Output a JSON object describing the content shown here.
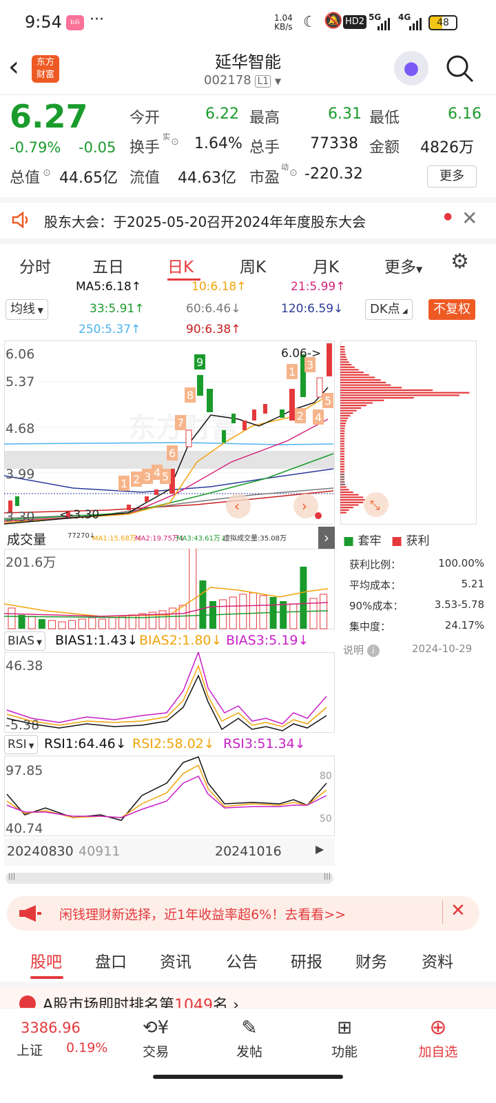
{
  "status_bar": {
    "time": "9:54",
    "app_badge": "bilibili",
    "dots": "···",
    "speed_val": "1.04",
    "speed_unit": "KB/s",
    "hd": "HD2",
    "net1": "5G",
    "net2": "4G",
    "battery": "48"
  },
  "nav": {
    "title": "延华智能",
    "code": "002178",
    "level": "L1",
    "logo_line1": "东方",
    "logo_line2": "财富"
  },
  "quote": {
    "price": "6.27",
    "change_pct": "-0.79%",
    "change": "-0.05",
    "open_label": "今开",
    "open": "6.22",
    "high_label": "最高",
    "high": "6.31",
    "low_label": "最低",
    "low": "6.16",
    "turnover_label": "换手",
    "turnover_sup": "实",
    "turnover": "1.64%",
    "volume_label": "总手",
    "volume": "77338",
    "amount_label": "金额",
    "amount": "4826万",
    "mcap_label": "总值",
    "mcap": "44.65亿",
    "float_label": "流值",
    "float": "44.63亿",
    "pe_label": "市盈",
    "pe_sup": "动",
    "pe": "-220.32",
    "more": "更多"
  },
  "notice": {
    "text": "股东大会：于2025-05-20召开2024年年度股东大会"
  },
  "period_tabs": [
    "分时",
    "五日",
    "日K",
    "周K",
    "月K",
    "更多"
  ],
  "active_tab": 2,
  "ma": {
    "ma_select": "均线",
    "ma5": "MA5:6.18↑",
    "ma10": "10:6.18↑",
    "ma21": "21:5.99↑",
    "ma33": "33:5.91↑",
    "ma60": "60:6.46↓",
    "ma120": "120:6.59↓",
    "ma250": "250:5.37↑",
    "ma90": "90:6.38↑",
    "dk": "DK点",
    "fuquan": "不复权"
  },
  "kline": {
    "y_labels": [
      "6.06",
      "5.37",
      "4.68",
      "3.99",
      "3.30"
    ],
    "high_annot": "6.06->",
    "low_annot": "<-3.30",
    "nine_labels": [
      "1",
      "2",
      "3",
      "4",
      "5",
      "7",
      "6",
      "8",
      "9",
      "1",
      "2",
      "3",
      "4",
      "5"
    ]
  },
  "colors": {
    "up": "#e4393c",
    "down": "#1a9b2c",
    "ma5": "#111111",
    "ma10": "#f0a30a",
    "ma21": "#d4237a",
    "ma33": "#1a9b2c",
    "ma60": "#777777",
    "ma120": "#2a3a9b",
    "ma250": "#4cb3f0",
    "ma90": "#c81e1e"
  },
  "volume_panel": {
    "label": "成交量",
    "vol": "77270↓",
    "ma1": "MA1:15.68万↓",
    "ma2": "MA2:19.75万↓",
    "ma3": "MA3:43.61万↓",
    "virtual": "虚拟成交量:35.08万",
    "ymax": "201.6万"
  },
  "chip_panel": {
    "legend_trapped": "套牢",
    "legend_profit": "获利",
    "rows": [
      [
        "获利比例：",
        "100.00%"
      ],
      [
        "平均成本：",
        "5.21"
      ],
      [
        "90%成本：",
        "3.53-5.78"
      ],
      [
        "集中度：",
        "24.17%"
      ]
    ],
    "explain": "说明",
    "date": "2024-10-29"
  },
  "bias_panel": {
    "label": "BIAS",
    "b1": "BIAS1:1.43↓",
    "b2": "BIAS2:1.80↓",
    "b3": "BIAS3:5.19↓",
    "ymax": "46.38",
    "ymin": "-5.38"
  },
  "rsi_panel": {
    "label": "RSI",
    "r1": "RSI1:64.46↓",
    "r2": "RSI2:58.02↓",
    "r3": "RSI3:51.34↓",
    "ymax": "97.85",
    "ymin": "40.74",
    "lvl80": "80",
    "lvl50": "50"
  },
  "x_dates": [
    "20240830",
    "40911",
    "20241016"
  ],
  "banner": {
    "text": "闲钱理财新选择，近1年收益率超6%！去看看>>"
  },
  "bottom_tabs": [
    "股吧",
    "盘口",
    "资讯",
    "公告",
    "研报",
    "财务",
    "资料"
  ],
  "peek": {
    "text_a": "A股市场即时排名第",
    "rank": "1049",
    "text_b": "名"
  },
  "dock": {
    "index_value": "3386.96",
    "index_name": "上证",
    "index_pct": "0.19%",
    "trade": "交易",
    "post": "发帖",
    "functions": "功能",
    "add": "加自选"
  }
}
